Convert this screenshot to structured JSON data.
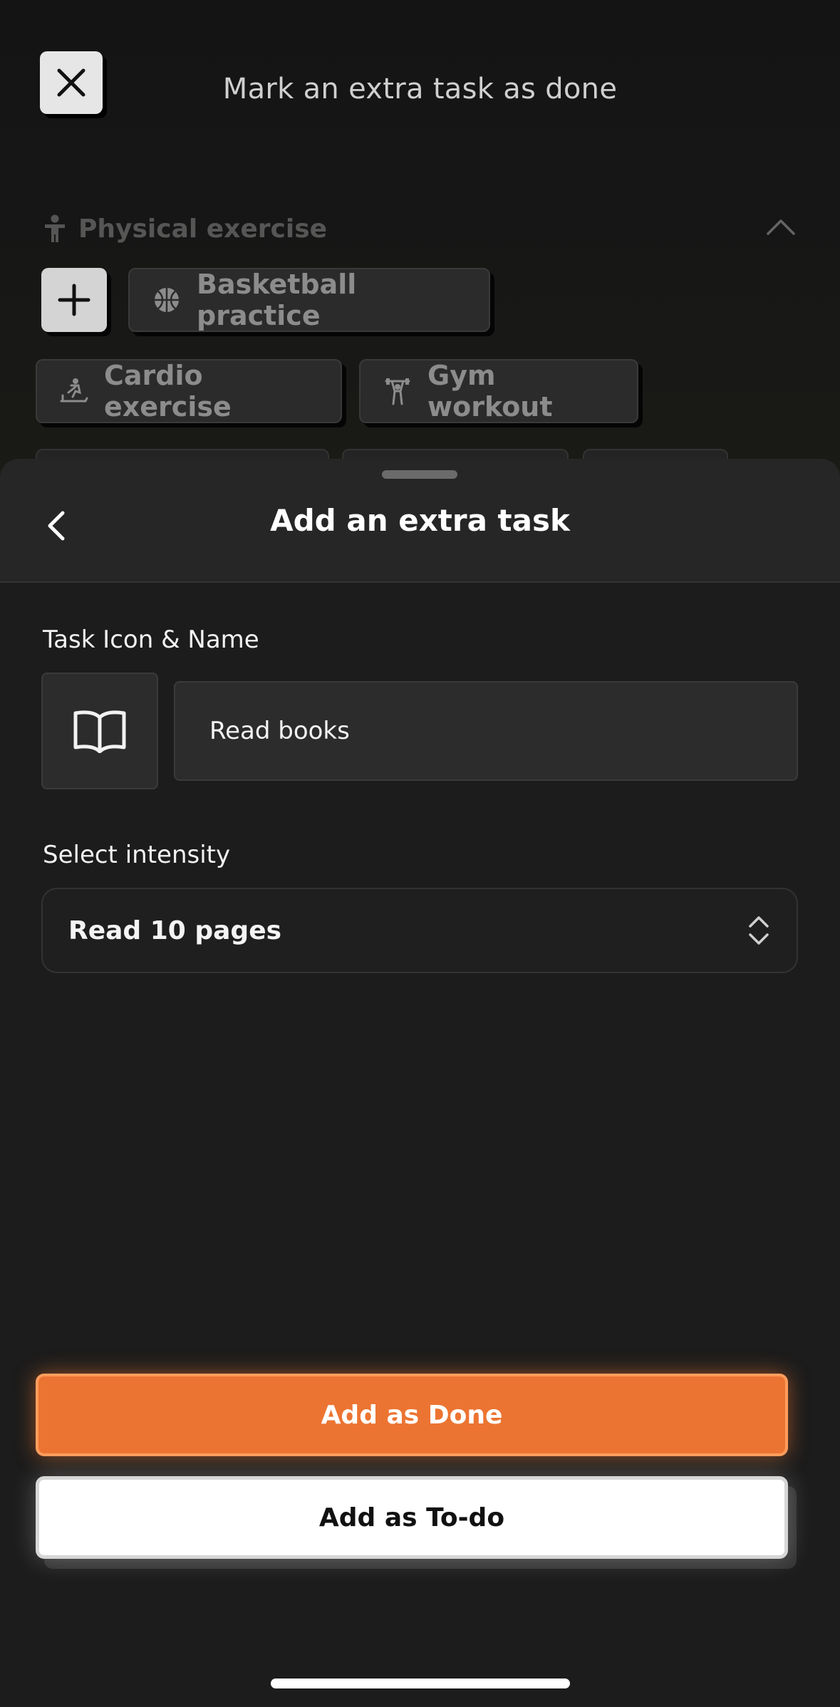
{
  "background": {
    "title": "Mark an extra task as done",
    "category": {
      "label": "Physical exercise",
      "icon": "person-icon",
      "expanded": true
    },
    "chips": [
      {
        "label": "Basketball practice",
        "icon": "basketball-icon"
      },
      {
        "label": "Cardio exercise",
        "icon": "treadmill-icon"
      },
      {
        "label": "Gym workout",
        "icon": "weightlifting-icon"
      }
    ]
  },
  "sheet": {
    "title": "Add an extra task",
    "task_label": "Task Icon & Name",
    "task_icon": "open-book-icon",
    "task_name": "Read books",
    "intensity_label": "Select intensity",
    "intensity_value": "Read 10 pages",
    "done_button": "Add as Done",
    "todo_button": "Add as To-do"
  },
  "colors": {
    "accent": "#ec7432",
    "sheet_bg": "#1c1c1c",
    "header_bg": "#262626"
  }
}
